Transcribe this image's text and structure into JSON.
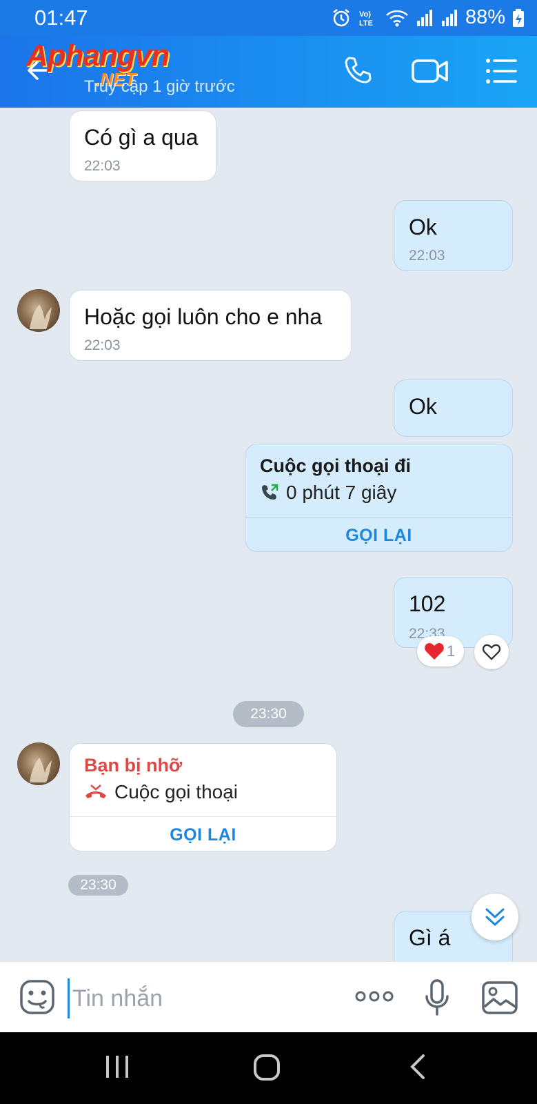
{
  "status_bar": {
    "time": "01:47",
    "battery": "88%"
  },
  "header": {
    "logo_main": "Aphangvn",
    "logo_sub": ".NET",
    "last_seen": "Truy cập 1 giờ trước",
    "accent": "#1b74ea"
  },
  "messages": [
    {
      "side": "in",
      "text": "Có gì a qua",
      "time": "22:03"
    },
    {
      "side": "out",
      "text": "Ok",
      "time": "22:03"
    },
    {
      "side": "in",
      "text": "Hoặc gọi luôn cho e nha",
      "time": "22:03"
    },
    {
      "side": "out",
      "text": "Ok"
    },
    {
      "side": "out",
      "type": "call",
      "title": "Cuộc gọi thoại đi",
      "detail": "0 phút 7 giây",
      "action": "GỌI LẠI"
    },
    {
      "side": "out",
      "text": "102",
      "time": "22:33",
      "reaction_count": "1"
    },
    {
      "type": "divider",
      "time": "23:30"
    },
    {
      "side": "in",
      "type": "missed_call",
      "title": "Bạn bị nhỡ",
      "detail": "Cuộc gọi thoại",
      "action": "GỌI LẠI",
      "time": "23:30"
    },
    {
      "side": "out",
      "text": "Gì á"
    }
  ],
  "composer": {
    "placeholder": "Tin nhắn"
  },
  "icons": [
    "back-arrow-icon",
    "phone-icon",
    "video-call-icon",
    "menu-icon",
    "emoji-icon",
    "more-icon",
    "mic-icon",
    "image-icon",
    "heart-icon",
    "scroll-down-icon"
  ]
}
